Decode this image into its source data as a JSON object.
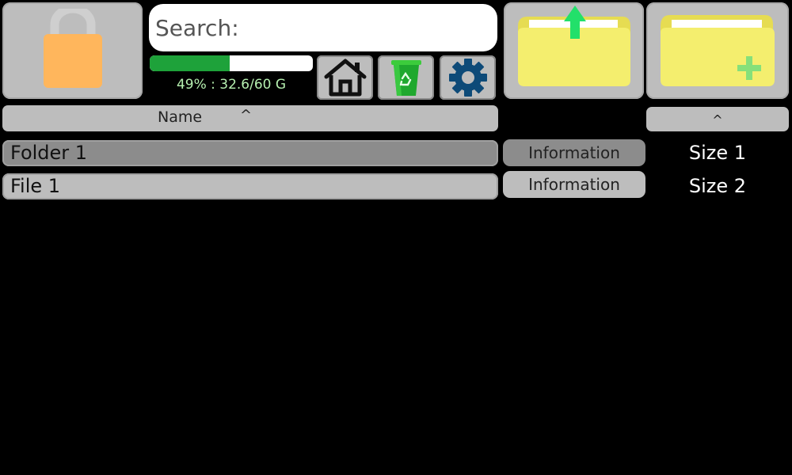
{
  "search": {
    "label": "Search:",
    "value": "",
    "placeholder": ""
  },
  "storage": {
    "percent": 49,
    "text": "49% : 32.6/60 G"
  },
  "icons": {
    "lock": "lock-icon",
    "home": "home-icon",
    "trash": "recycle-bin-icon",
    "settings": "gear-icon",
    "folder_up": "folder-up-icon",
    "new_folder": "new-folder-icon"
  },
  "columns": {
    "name_label": "Name",
    "name_sort": "^",
    "size_sort": "^"
  },
  "files": [
    {
      "name": "Folder 1",
      "info_label": "Information",
      "size": "Size 1",
      "selected": true
    },
    {
      "name": "File 1",
      "info_label": "Information",
      "size": "Size 2",
      "selected": false
    }
  ],
  "colors": {
    "background": "#000000",
    "tile": "#bdbdbd",
    "selected_row": "#8c8c8c",
    "storage_fill": "#1ea23a",
    "storage_text": "#b6f0b0",
    "lock_body": "#ffb65c",
    "folder": "#f4ee6e",
    "accent_green": "#22e06a",
    "settings_blue": "#0d4a78"
  }
}
